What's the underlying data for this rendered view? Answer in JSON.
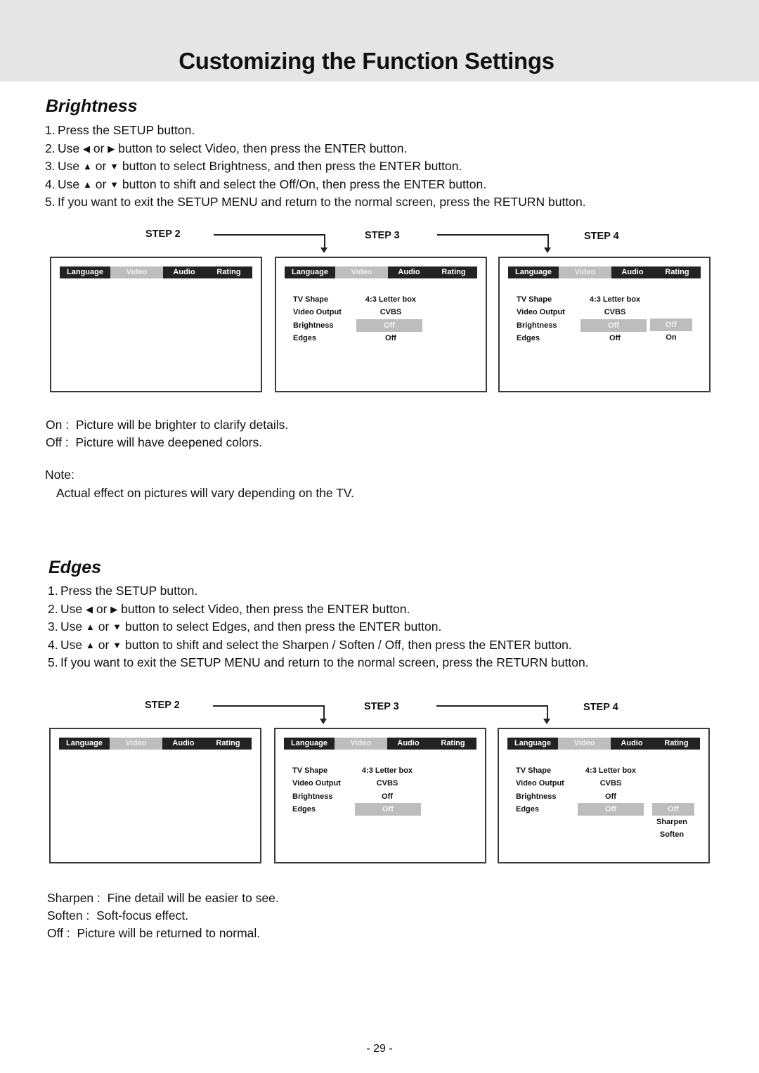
{
  "page": {
    "title": "Customizing the Function Settings",
    "page_number": "- 29 -",
    "header_band_color": "#e5e5e5"
  },
  "brightness": {
    "title": "Brightness",
    "steps": [
      {
        "num": "1.",
        "parts": [
          "Press the SETUP button."
        ]
      },
      {
        "num": "2.",
        "pre": "Use ",
        "icon1": "◀",
        "mid": " or ",
        "icon2": "▶",
        "post": " button to select Video, then press the ENTER button."
      },
      {
        "num": "3.",
        "pre": "Use ",
        "icon1": "▲",
        "mid": " or ",
        "icon2": "▼",
        "post": " button to select Brightness, and then press the ENTER button."
      },
      {
        "num": "4.",
        "pre": "Use ",
        "icon1": "▲",
        "mid": " or ",
        "icon2": "▼",
        "post": " button to shift and select the Off/On, then press the ENTER button."
      },
      {
        "num": "5.",
        "parts": [
          "If you want to exit the SETUP MENU and return to the normal screen, press the RETURN button."
        ]
      }
    ],
    "diagram": {
      "step_labels": [
        "STEP 2",
        "STEP 3",
        "STEP 4"
      ],
      "tabs": [
        "Language",
        "Video",
        "Audio",
        "Rating"
      ],
      "active_tab": "Video",
      "rows": [
        {
          "label": "TV Shape",
          "value": "4:3 Letter box"
        },
        {
          "label": "Video Output",
          "value": "CVBS"
        },
        {
          "label": "Brightness",
          "value": "Off",
          "highlighted": true
        },
        {
          "label": "Edges",
          "value": "Off"
        }
      ],
      "options": [
        {
          "label": "Off",
          "highlighted": true
        },
        {
          "label": "On"
        }
      ]
    },
    "descriptions": [
      {
        "key": "On :",
        "text": "Picture will be brighter to clarify details."
      },
      {
        "key": "Off :",
        "text": "Picture will have deepened colors."
      }
    ],
    "note_label": "Note:",
    "note_text": "Actual effect on pictures will vary depending on the TV."
  },
  "edges": {
    "title": "Edges",
    "steps": [
      {
        "num": "1.",
        "parts": [
          "Press the SETUP button."
        ]
      },
      {
        "num": "2.",
        "pre": "Use ",
        "icon1": "◀",
        "mid": " or ",
        "icon2": "▶",
        "post": " button to select Video, then press the ENTER button."
      },
      {
        "num": "3.",
        "pre": "Use ",
        "icon1": "▲",
        "mid": " or ",
        "icon2": "▼",
        "post": " button to select Edges, and then press the ENTER button."
      },
      {
        "num": "4.",
        "pre": "Use ",
        "icon1": "▲",
        "mid": " or ",
        "icon2": "▼",
        "post": " button to shift and select the Sharpen / Soften / Off, then press the ENTER button."
      },
      {
        "num": "5.",
        "parts": [
          "If you want to exit the SETUP MENU and return to the normal screen, press the RETURN button."
        ]
      }
    ],
    "diagram": {
      "step_labels": [
        "STEP 2",
        "STEP 3",
        "STEP 4"
      ],
      "tabs": [
        "Language",
        "Video",
        "Audio",
        "Rating"
      ],
      "active_tab": "Video",
      "rows": [
        {
          "label": "TV Shape",
          "value": "4:3 Letter box"
        },
        {
          "label": "Video Output",
          "value": "CVBS"
        },
        {
          "label": "Brightness",
          "value": "Off"
        },
        {
          "label": "Edges",
          "value": "Off",
          "highlighted": true
        }
      ],
      "options": [
        {
          "label": "Off",
          "highlighted": true
        },
        {
          "label": "Sharpen"
        },
        {
          "label": "Soften"
        }
      ]
    },
    "descriptions": [
      {
        "key": "Sharpen :",
        "text": "Fine detail will be easier to see."
      },
      {
        "key": "Soften :",
        "text": "Soft-focus effect."
      },
      {
        "key": "Off :",
        "text": "Picture will be returned to normal."
      }
    ]
  }
}
